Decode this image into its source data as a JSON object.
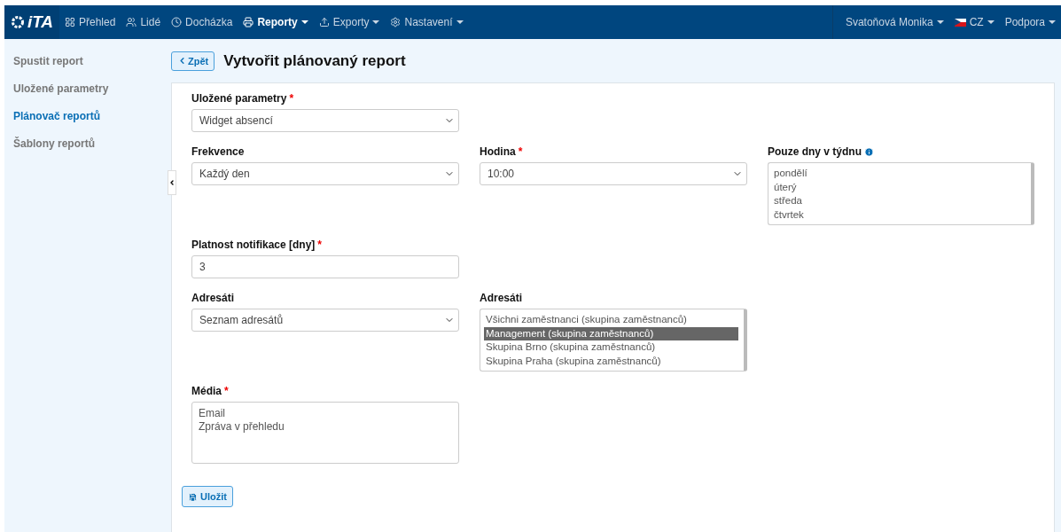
{
  "navbar": {
    "logo": "iTA",
    "items": [
      {
        "label": "Přehled",
        "active": false,
        "dropdown": false
      },
      {
        "label": "Lidé",
        "active": false,
        "dropdown": false
      },
      {
        "label": "Docházka",
        "active": false,
        "dropdown": false
      },
      {
        "label": "Reporty",
        "active": true,
        "dropdown": true
      },
      {
        "label": "Exporty",
        "active": false,
        "dropdown": true
      },
      {
        "label": "Nastavení",
        "active": false,
        "dropdown": true
      }
    ],
    "right": [
      {
        "label": "Svatoňová Monika",
        "flag": false
      },
      {
        "label": "CZ",
        "flag": true
      },
      {
        "label": "Podpora",
        "flag": false
      }
    ]
  },
  "sidebar": {
    "items": [
      {
        "label": "Spustit report",
        "selected": false
      },
      {
        "label": "Uložené parametry",
        "selected": false
      },
      {
        "label": "Plánovač reportů",
        "selected": true
      },
      {
        "label": "Šablony reportů",
        "selected": false
      }
    ]
  },
  "header": {
    "back_button": "Zpět",
    "title": "Vytvořit plánovaný report"
  },
  "form": {
    "rows": [
      [
        {
          "kind": "select",
          "label": "Uložené parametry",
          "required_mark": "*",
          "value": "Widget absencí"
        }
      ],
      [
        {
          "kind": "select",
          "label": "Frekvence",
          "value": "Každý den"
        },
        {
          "kind": "select",
          "label": "Hodina",
          "required_mark": "*",
          "value": "10:00"
        },
        {
          "kind": "listbox",
          "label": "Pouze dny v týdnu",
          "info": true,
          "options": [
            {
              "label": "pondělí",
              "selected": false
            },
            {
              "label": "úterý",
              "selected": false
            },
            {
              "label": "středa",
              "selected": false
            },
            {
              "label": "čtvrtek",
              "selected": false
            }
          ]
        }
      ],
      [
        {
          "kind": "input",
          "label": "Platnost notifikace [dny]",
          "required_mark": "*",
          "value": "3"
        }
      ],
      [
        {
          "kind": "select",
          "label": "Adresáti",
          "value": "Seznam adresátů"
        },
        {
          "kind": "listbox",
          "label": "Adresáti",
          "info": false,
          "options": [
            {
              "label": "Všichni zaměstnanci (skupina zaměstnanců)",
              "selected": false
            },
            {
              "label": "Management (skupina zaměstnanců)",
              "selected": true
            },
            {
              "label": "Skupina Brno (skupina zaměstnanců)",
              "selected": false
            },
            {
              "label": "Skupina Praha (skupina zaměstnanců)",
              "selected": false
            }
          ]
        }
      ],
      [
        {
          "kind": "textarea",
          "label": "Média",
          "required_mark": "*",
          "value": "Email\nZpráva v přehledu"
        }
      ]
    ],
    "save_button": "Uložit"
  }
}
